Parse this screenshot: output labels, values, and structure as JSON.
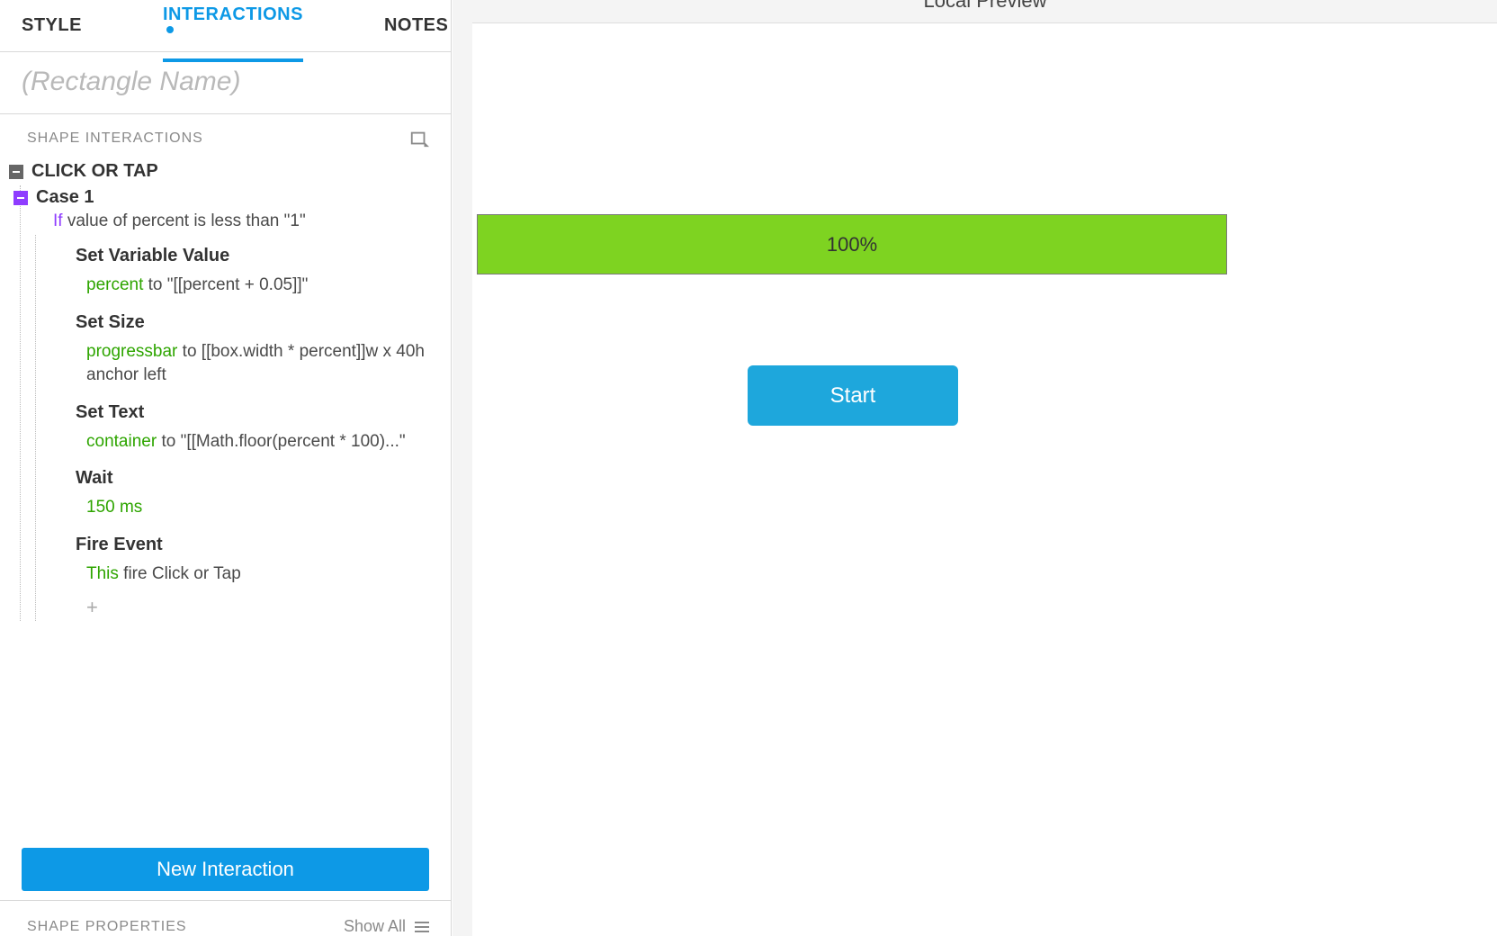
{
  "tabs": {
    "style": "STYLE",
    "interactions": "INTERACTIONS",
    "notes": "NOTES"
  },
  "name_placeholder": "(Rectangle Name)",
  "section_title": "SHAPE INTERACTIONS",
  "event": {
    "label": "CLICK OR TAP"
  },
  "case": {
    "label": "Case 1",
    "if": "If",
    "condition": "value of percent is less than \"1\""
  },
  "actions": [
    {
      "title": "Set Variable Value",
      "target": "percent",
      "rest": " to \"[[percent + 0.05]]\""
    },
    {
      "title": "Set Size",
      "target": "progressbar",
      "rest": " to [[box.width * percent]]w x 40h anchor left"
    },
    {
      "title": "Set Text",
      "target": "container",
      "rest": " to \"[[Math.floor(percent * 100)...\""
    },
    {
      "title": "Wait",
      "target": "150 ms",
      "rest": ""
    },
    {
      "title": "Fire Event",
      "target": "This",
      "rest": " fire Click or Tap"
    }
  ],
  "new_interaction": "New Interaction",
  "shape_properties": "SHAPE PROPERTIES",
  "show_all": "Show All",
  "preview_header": "Local Preview",
  "progress_text": "100%",
  "start_label": "Start"
}
